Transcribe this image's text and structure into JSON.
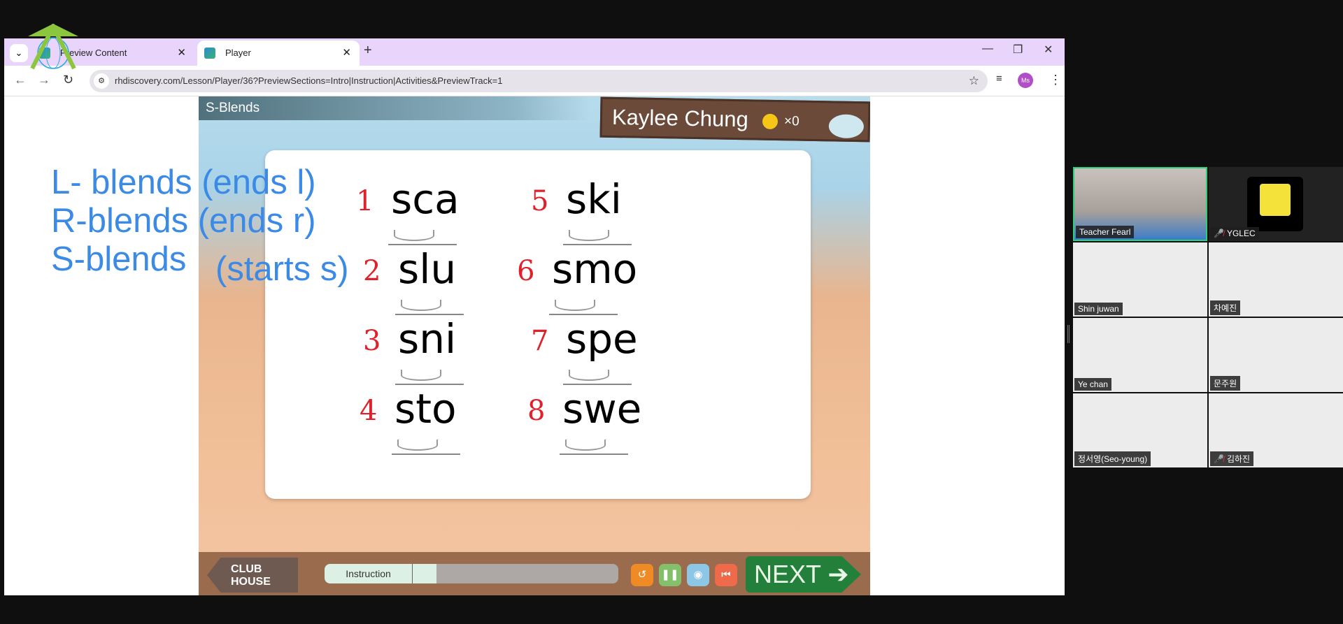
{
  "browser": {
    "tabs": [
      {
        "label": "Preview Content"
      },
      {
        "label": "Player"
      }
    ],
    "url": "rhdiscovery.com/Lesson/Player/36?PreviewSections=Intro|Instruction|Activities&PreviewTrack=1",
    "profile_initials": "Ms"
  },
  "notes": [
    "L- blends (ends l)",
    "R-blends (ends r)",
    "S-blends",
    "(starts s)"
  ],
  "player": {
    "title": "S-Blends",
    "student_name": "Kaylee Chung",
    "coin_count": "×0",
    "words": [
      {
        "num": "1",
        "word": "sca"
      },
      {
        "num": "2",
        "word": "slu"
      },
      {
        "num": "3",
        "word": "sni"
      },
      {
        "num": "4",
        "word": "sto"
      },
      {
        "num": "5",
        "word": "ski"
      },
      {
        "num": "6",
        "word": "smo"
      },
      {
        "num": "7",
        "word": "spe"
      },
      {
        "num": "8",
        "word": "swe"
      }
    ],
    "clubhouse_label": "CLUB HOUSE",
    "section_label": "Instruction",
    "progress_percent": 38,
    "next_label": "NEXT"
  },
  "meeting": {
    "participants": [
      {
        "name": "Teacher Fearl",
        "muted": false,
        "active": true
      },
      {
        "name": "YGLEC",
        "muted": true
      },
      {
        "name": "Shin juwan",
        "muted": false
      },
      {
        "name": "차예진",
        "muted": false
      },
      {
        "name": "Ye chan",
        "muted": false
      },
      {
        "name": "문주원",
        "muted": false
      },
      {
        "name": "정서영(Seo-young)",
        "muted": false
      },
      {
        "name": "김하진",
        "muted": true
      }
    ]
  },
  "colors": {
    "accent": "#3b8ae6",
    "annotation": "#e0202a",
    "next": "#22803a",
    "active_speaker": "#2ad07a"
  }
}
